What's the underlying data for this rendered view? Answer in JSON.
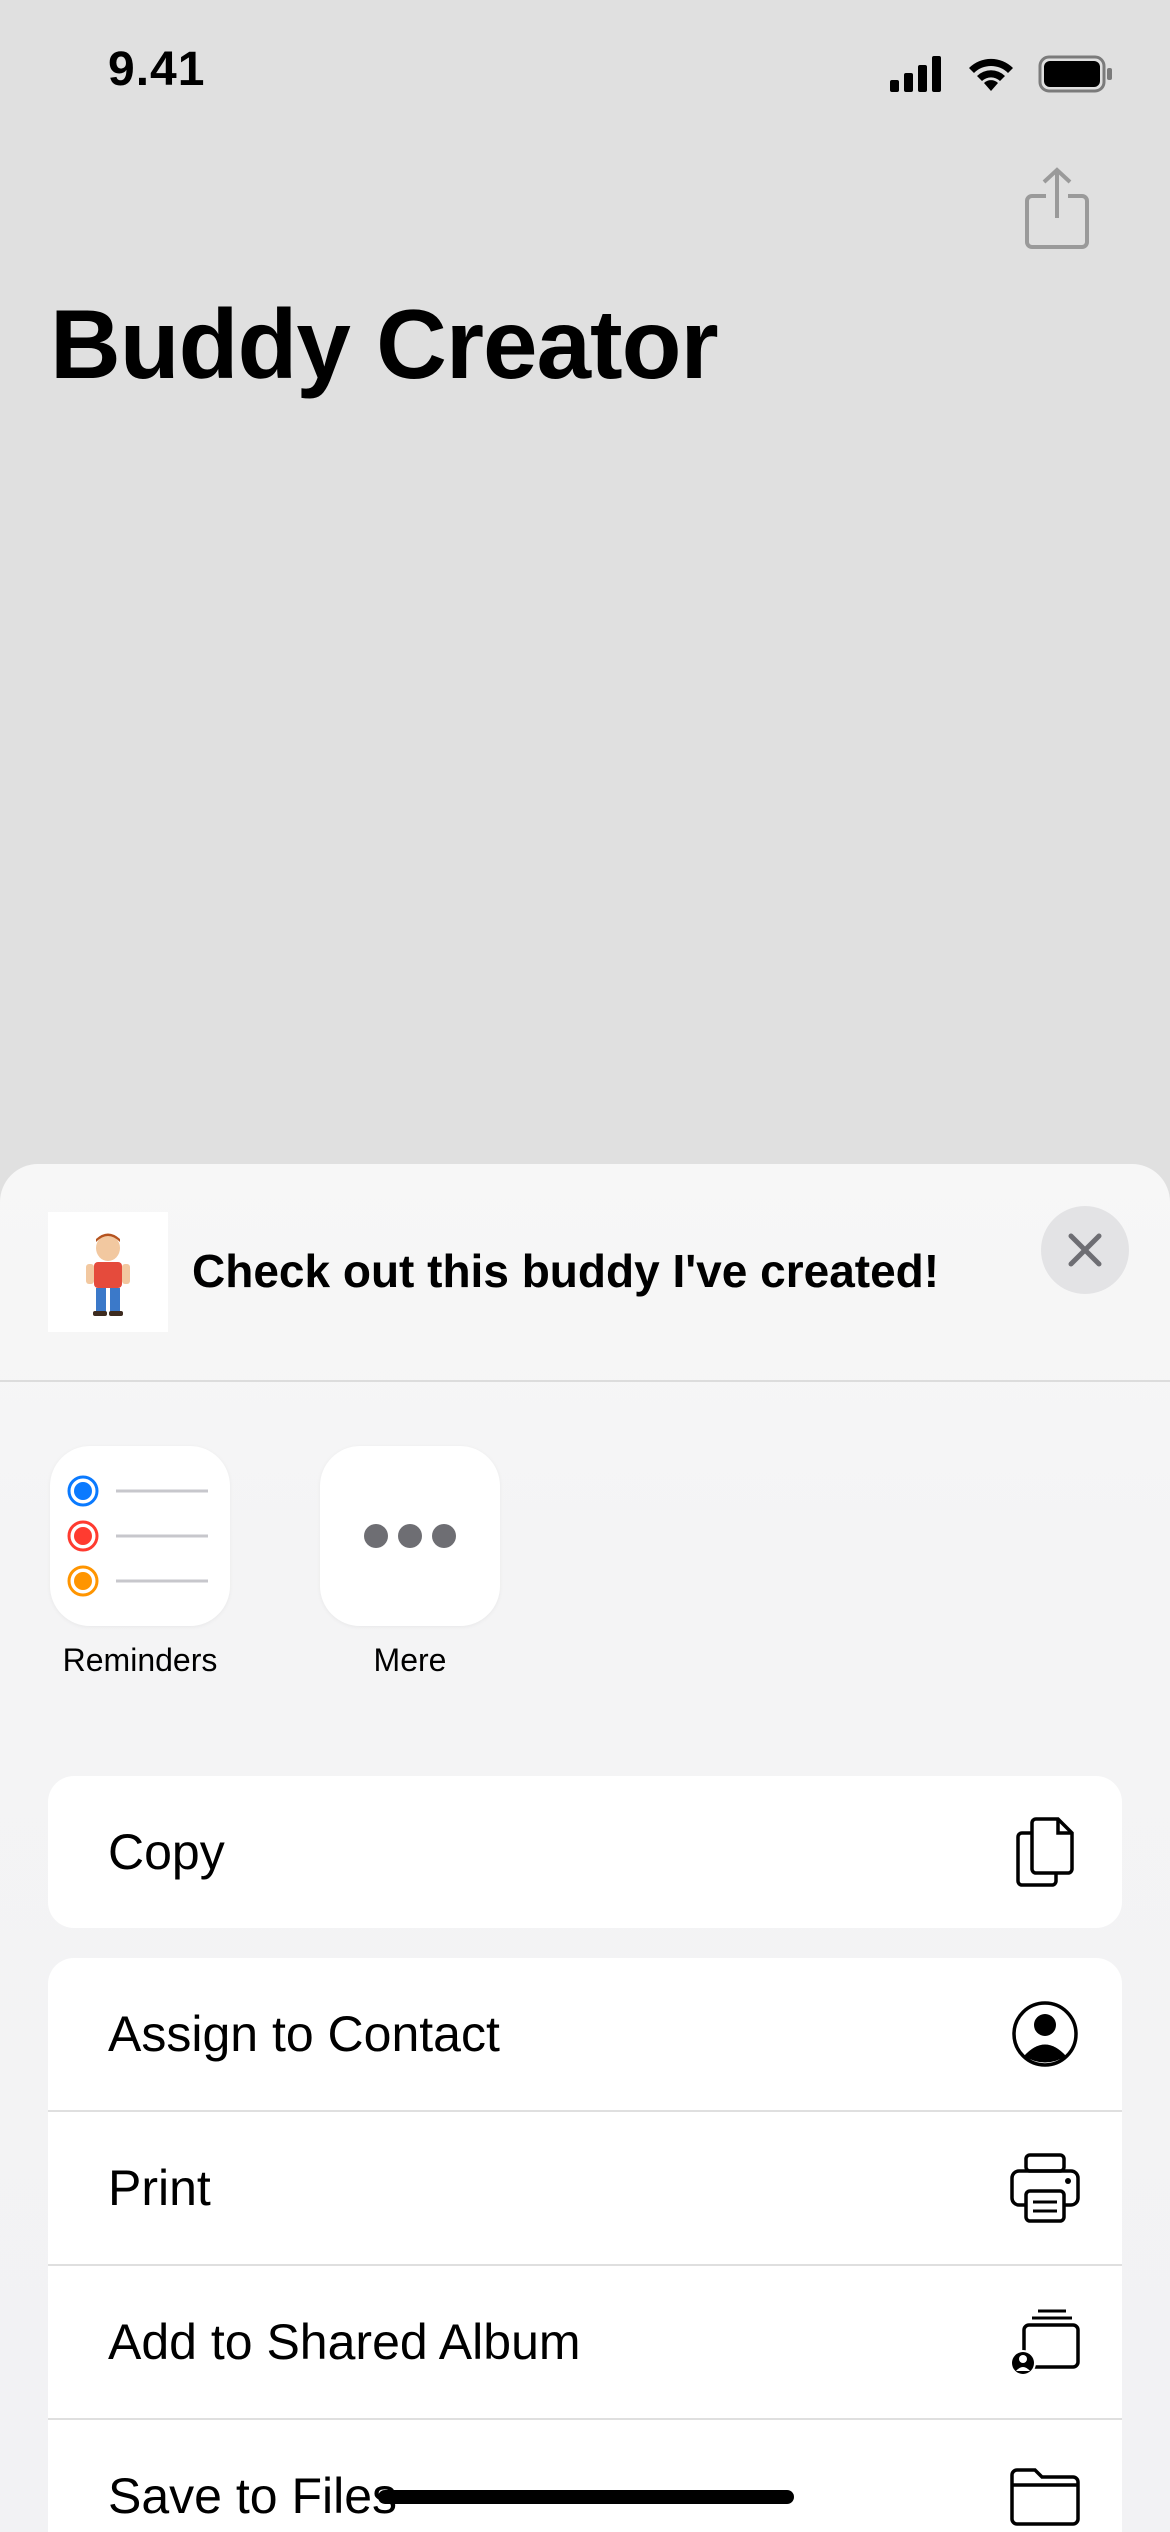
{
  "status": {
    "time": "9.41"
  },
  "app": {
    "title": "Buddy Creator"
  },
  "share_sheet": {
    "message": "Check out this buddy I've created!",
    "apps": [
      {
        "label": "Reminders",
        "icon": "reminders-icon"
      },
      {
        "label": "Mere",
        "icon": "more-icon"
      }
    ],
    "actions": [
      {
        "label": "Copy",
        "icon": "copy-icon"
      },
      {
        "label": "Assign to Contact",
        "icon": "contact-icon"
      },
      {
        "label": "Print",
        "icon": "printer-icon"
      },
      {
        "label": "Add to Shared Album",
        "icon": "shared-album-icon"
      },
      {
        "label": "Save to Files",
        "icon": "folder-icon"
      }
    ]
  },
  "colors": {
    "background": "#e0e0e0",
    "sheet": "#f4f4f5",
    "reminder_blue": "#0a7aff",
    "reminder_red": "#ff3b30",
    "reminder_orange": "#ff9500",
    "more_dots": "#6e6e73"
  }
}
